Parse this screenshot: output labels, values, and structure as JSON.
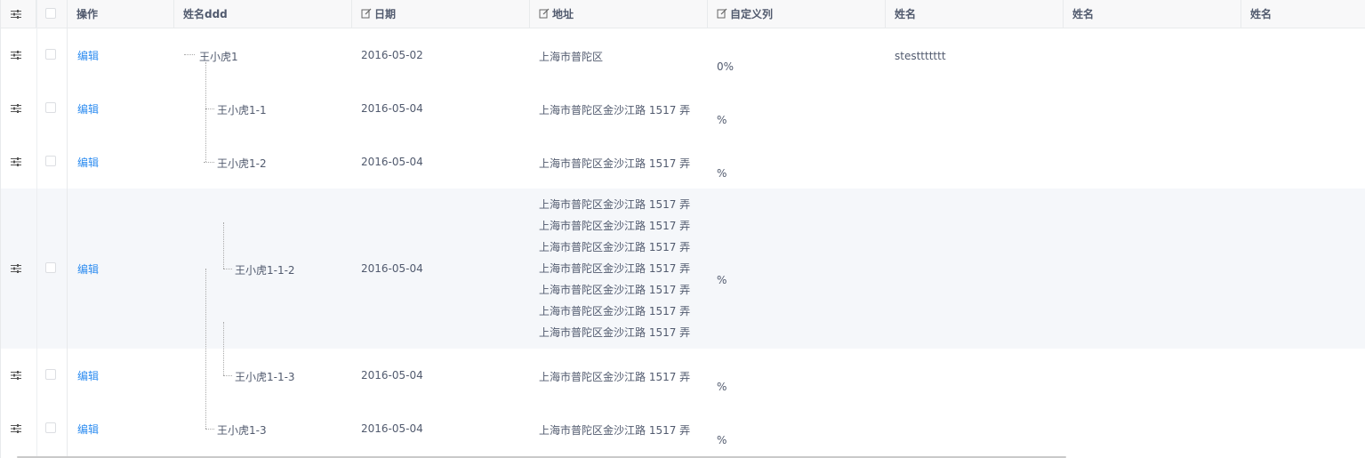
{
  "header": {
    "settings_icon": "sliders-icon",
    "col_action": "操作",
    "col_name": "姓名ddd",
    "col_date": "日期",
    "col_address": "地址",
    "col_custom": "自定义列",
    "col_name2": "姓名",
    "col_name3": "姓名",
    "col_name4": "姓名"
  },
  "rows": [
    {
      "action": "编辑",
      "name": "王小虎1",
      "date": "2016-05-02",
      "address": "上海市普陀区",
      "custom": "0%",
      "name2": "stesttttttt"
    },
    {
      "action": "编辑",
      "name": "王小虎1-1",
      "date": "2016-05-04",
      "address": "上海市普陀区金沙江路 1517 弄",
      "custom": "%"
    },
    {
      "action": "编辑",
      "name": "王小虎1-2",
      "date": "2016-05-04",
      "address": "上海市普陀区金沙江路 1517 弄",
      "custom": "%"
    },
    {
      "action": "编辑",
      "name": "王小虎1-1-2",
      "date": "2016-05-04",
      "address": "上海市普陀区金沙江路 1517 弄上海市普陀区金沙江路 1517 弄上海市普陀区金沙江路 1517 弄上海市普陀区金沙江路 1517 弄上海市普陀区金沙江路 1517 弄上海市普陀区金沙江路 1517 弄上海市普陀区金沙江路 1517 弄",
      "custom": "%"
    },
    {
      "action": "编辑",
      "name": "王小虎1-1-3",
      "date": "2016-05-04",
      "address": "上海市普陀区金沙江路 1517 弄",
      "custom": "%"
    },
    {
      "action": "编辑",
      "name": "王小虎1-3",
      "date": "2016-05-04",
      "address": "上海市普陀区金沙江路 1517 弄",
      "custom": "%"
    }
  ]
}
